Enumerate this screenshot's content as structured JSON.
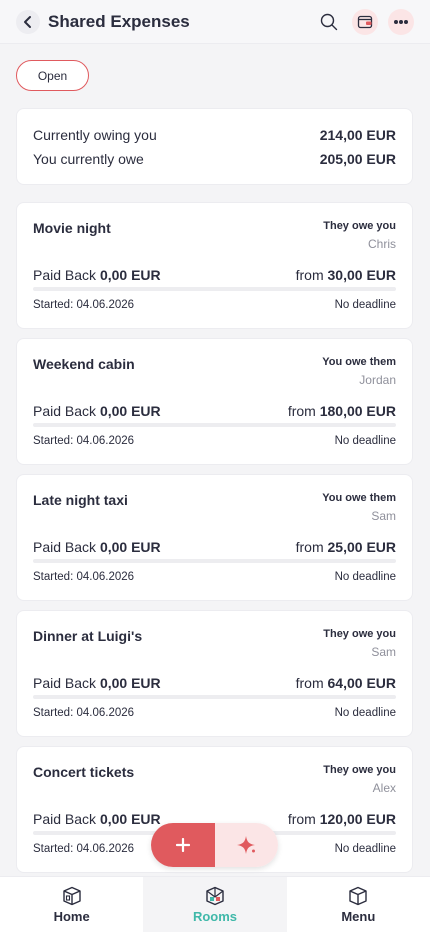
{
  "header": {
    "title": "Shared Expenses"
  },
  "filter": {
    "label": "Open"
  },
  "summary": {
    "owing_you_label": "Currently owing you",
    "owing_you_value": "214,00 EUR",
    "you_owe_label": "You currently owe",
    "you_owe_value": "205,00 EUR"
  },
  "expenses": [
    {
      "name": "Movie night",
      "direction": "They owe you",
      "person": "Chris",
      "paid_label": "Paid Back",
      "paid_value": "0,00 EUR",
      "from_label": "from",
      "from_value": "30,00 EUR",
      "started": "Started: 04.06.2026",
      "deadline": "No deadline",
      "progress": 0
    },
    {
      "name": "Weekend cabin",
      "direction": "You owe them",
      "person": "Jordan",
      "paid_label": "Paid Back",
      "paid_value": "0,00 EUR",
      "from_label": "from",
      "from_value": "180,00 EUR",
      "started": "Started: 04.06.2026",
      "deadline": "No deadline",
      "progress": 0
    },
    {
      "name": "Late night taxi",
      "direction": "You owe them",
      "person": "Sam",
      "paid_label": "Paid Back",
      "paid_value": "0,00 EUR",
      "from_label": "from",
      "from_value": "25,00 EUR",
      "started": "Started: 04.06.2026",
      "deadline": "No deadline",
      "progress": 0
    },
    {
      "name": "Dinner at Luigi's",
      "direction": "They owe you",
      "person": "Sam",
      "paid_label": "Paid Back",
      "paid_value": "0,00 EUR",
      "from_label": "from",
      "from_value": "64,00 EUR",
      "started": "Started: 04.06.2026",
      "deadline": "No deadline",
      "progress": 0
    },
    {
      "name": "Concert tickets",
      "direction": "They owe you",
      "person": "Alex",
      "paid_label": "Paid Back",
      "paid_value": "0,00 EUR",
      "from_label": "from",
      "from_value": "120,00 EUR",
      "started": "Started: 04.06.2026",
      "deadline": "No deadline",
      "progress": 0
    }
  ],
  "fab": {
    "add_icon": "plus-icon",
    "ai_icon": "sparkle-icon"
  },
  "nav": [
    {
      "label": "Home",
      "icon": "home-box-icon",
      "active": false
    },
    {
      "label": "Rooms",
      "icon": "rooms-icon",
      "active": true
    },
    {
      "label": "Menu",
      "icon": "menu-cube-icon",
      "active": false
    }
  ],
  "colors": {
    "accent": "#e05a5e",
    "accent_light": "#fbe5e6",
    "active_nav": "#3fb8a9",
    "text": "#2b2d3e",
    "muted": "#8f909b"
  }
}
